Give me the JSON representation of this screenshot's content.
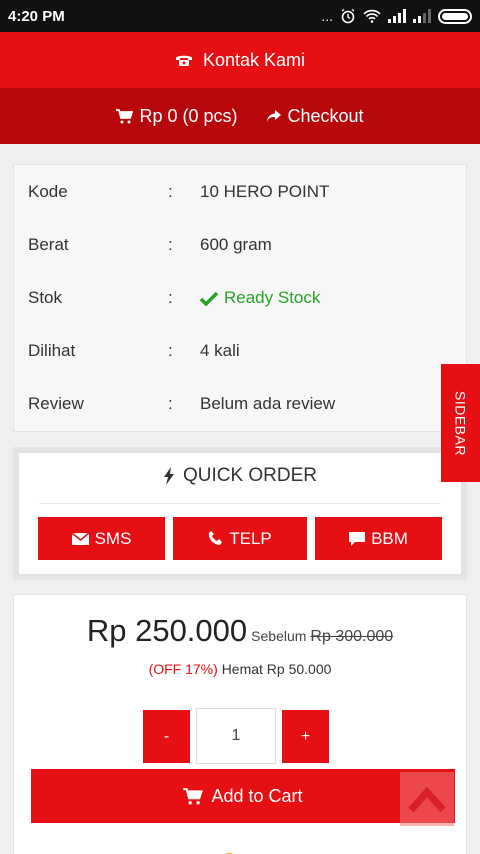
{
  "status": {
    "time": "4:20 PM",
    "dots": "..."
  },
  "header": {
    "contact_label": "Kontak Kami",
    "cart_label": "Rp 0 (0 pcs)",
    "checkout_label": "Checkout"
  },
  "product": {
    "rows": [
      {
        "key": "Kode",
        "sep": ":",
        "value": "10 HERO POINT"
      },
      {
        "key": "Berat",
        "sep": ":",
        "value": "600 gram"
      },
      {
        "key": "Stok",
        "sep": ":",
        "value": "Ready Stock"
      },
      {
        "key": "Dilihat",
        "sep": ":",
        "value": "4 kali"
      },
      {
        "key": "Review",
        "sep": ":",
        "value": "Belum ada review"
      }
    ]
  },
  "quick_order": {
    "title": "QUICK ORDER",
    "sms": "SMS",
    "telp": "TELP",
    "bbm": "BBM"
  },
  "price": {
    "now": "Rp 250.000",
    "before_label": "Sebelum",
    "before": "Rp 300.000",
    "off": "(OFF 17%)",
    "saving": "Hemat Rp 50.000",
    "minus": "-",
    "qty": "1",
    "plus": "+",
    "add_to_cart": "Add to Cart"
  },
  "sidebar": {
    "label": "SIDEBAR"
  },
  "colors": {
    "brand_red": "#e60f14",
    "dark_red": "#b8070b",
    "stock_green": "#27a127"
  }
}
